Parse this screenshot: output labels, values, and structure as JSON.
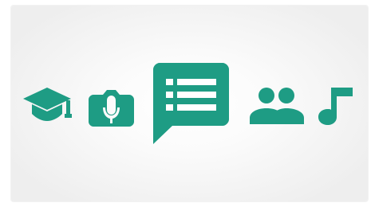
{
  "palette": {
    "accent": "#1e9c84",
    "background": "#ffffff",
    "card_edge": "#eeeeee",
    "card_center": "#ffffff"
  },
  "icons": [
    {
      "name": "graduation-cap-icon"
    },
    {
      "name": "camera-microphone-icon"
    },
    {
      "name": "form-chat-bubble-icon"
    },
    {
      "name": "people-group-icon"
    },
    {
      "name": "music-note-icon"
    }
  ]
}
